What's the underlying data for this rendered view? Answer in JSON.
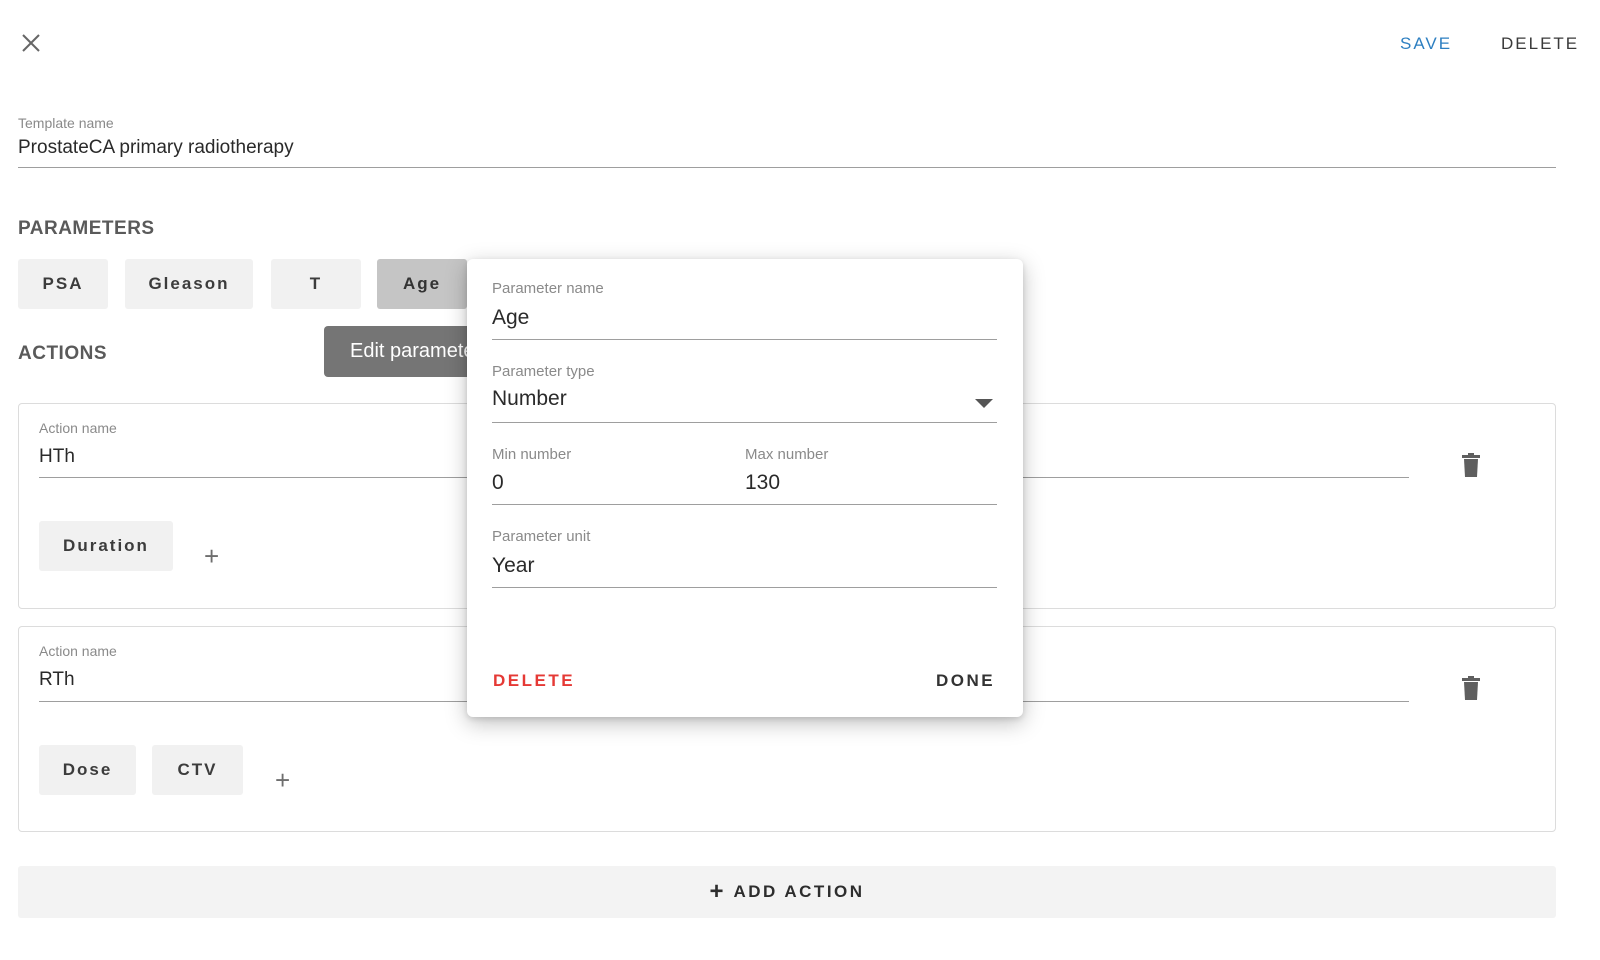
{
  "header": {
    "close_icon": "close-icon",
    "save_label": "SAVE",
    "delete_label": "DELETE",
    "save_color": "#2d7fc1"
  },
  "template": {
    "label": "Template name",
    "value": "ProstateCA primary radiotherapy"
  },
  "parameters": {
    "title": "PARAMETERS",
    "chips": [
      "PSA",
      "Gleason",
      "T",
      "Age"
    ],
    "selected": "Age"
  },
  "actions": {
    "title": "ACTIONS",
    "tooltip": "Edit parameter",
    "items": [
      {
        "label": "Action name",
        "name": "HTh",
        "params": [
          "Duration"
        ]
      },
      {
        "label": "Action name",
        "name": "RTh",
        "params": [
          "Dose",
          "CTV"
        ]
      }
    ],
    "add_label": "ADD ACTION",
    "add_icon": "+"
  },
  "popup": {
    "name_label": "Parameter name",
    "name_value": "Age",
    "type_label": "Parameter type",
    "type_value": "Number",
    "min_label": "Min number",
    "min_value": "0",
    "max_label": "Max number",
    "max_value": "130",
    "unit_label": "Parameter unit",
    "unit_value": "Year",
    "delete_label": "DELETE",
    "done_label": "DONE",
    "delete_color": "#e53935"
  }
}
